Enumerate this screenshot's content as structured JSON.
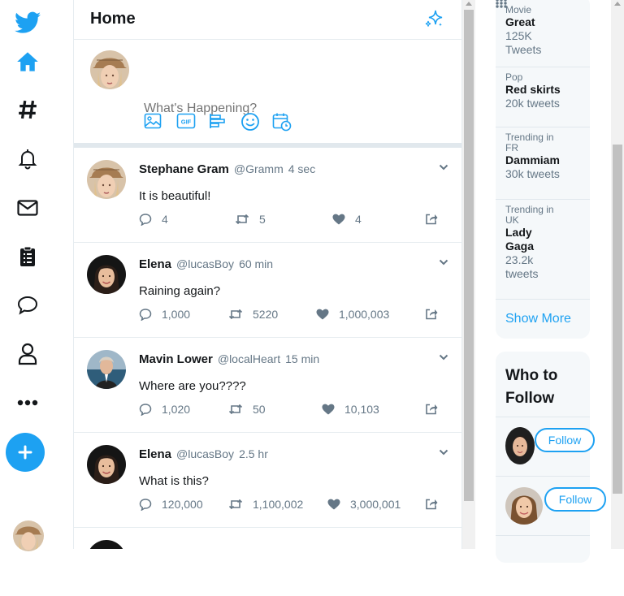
{
  "nav": {
    "icons": [
      "twitter-logo-icon",
      "home-icon",
      "hashtag-icon",
      "bell-icon",
      "mail-icon",
      "lists-icon",
      "message-icon",
      "profile-icon",
      "more-icon"
    ],
    "compose_icon": "plus-icon",
    "accent": "#1da1f2"
  },
  "feed": {
    "title": "Home",
    "compose_placeholder": "What's Happening?",
    "compose_tools": [
      "image-icon",
      "gif-icon",
      "poll-icon",
      "emoji-icon",
      "schedule-icon"
    ],
    "tweets": [
      {
        "name": "Stephane Gram",
        "handle": "@Gramm",
        "time": "4 sec",
        "text": "It is beautiful!",
        "replies": "4",
        "retweets": "5",
        "likes": "4",
        "liked": false,
        "avatar": "hat-woman"
      },
      {
        "name": "Elena",
        "handle": "@lucasBoy",
        "time": "60 min",
        "text": "Raining again?",
        "replies": "1,000",
        "retweets": "5220",
        "likes": "1,000,003",
        "liked": true,
        "avatar": "dark-hair-woman"
      },
      {
        "name": "Mavin Lower",
        "handle": "@localHeart",
        "time": "15 min",
        "text": "Where are you????",
        "replies": "1,020",
        "retweets": "50",
        "likes": "10,103",
        "liked": true,
        "avatar": "sea-man"
      },
      {
        "name": "Elena",
        "handle": "@lucasBoy",
        "time": "2.5 hr",
        "text": "What is this?",
        "replies": "120,000",
        "retweets": "1,100,002",
        "likes": "3,000,001",
        "liked": true,
        "avatar": "dark-hair-woman"
      }
    ]
  },
  "trends": {
    "items": [
      {
        "category": "Movie",
        "title": "Great",
        "count": "125K Tweets"
      },
      {
        "category": "Pop",
        "title": "Red skirts",
        "count": "20k tweets"
      },
      {
        "category": "Trending in FR",
        "title": "Dammiam",
        "count": "30k tweets"
      },
      {
        "category": "Trending in UK",
        "title": "Lady Gaga",
        "count": "23.2k tweets"
      }
    ],
    "show_more": "Show More"
  },
  "who_to_follow": {
    "title": "Who to Follow",
    "follow_label": "Follow"
  }
}
